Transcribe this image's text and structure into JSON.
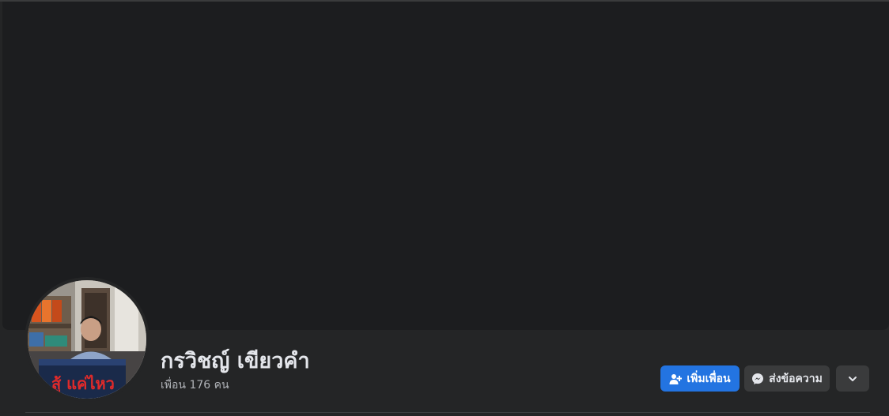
{
  "profile": {
    "name": "กรวิชญ์ เขียวคำ",
    "friends_text": "เพื่อน 176 คน"
  },
  "actions": {
    "add_friend_label": "เพิ่มเพื่อน",
    "message_label": "ส่งข้อความ"
  },
  "icons": {
    "add_friend": "user-plus-icon",
    "message": "messenger-icon",
    "more": "chevron-down-icon"
  },
  "colors": {
    "background": "#242526",
    "cover": "#1c1d1f",
    "primary_button": "#2374e1",
    "secondary_button": "#3a3b3c",
    "name_text": "#e4e6eb",
    "secondary_text": "#b0b3b8"
  }
}
